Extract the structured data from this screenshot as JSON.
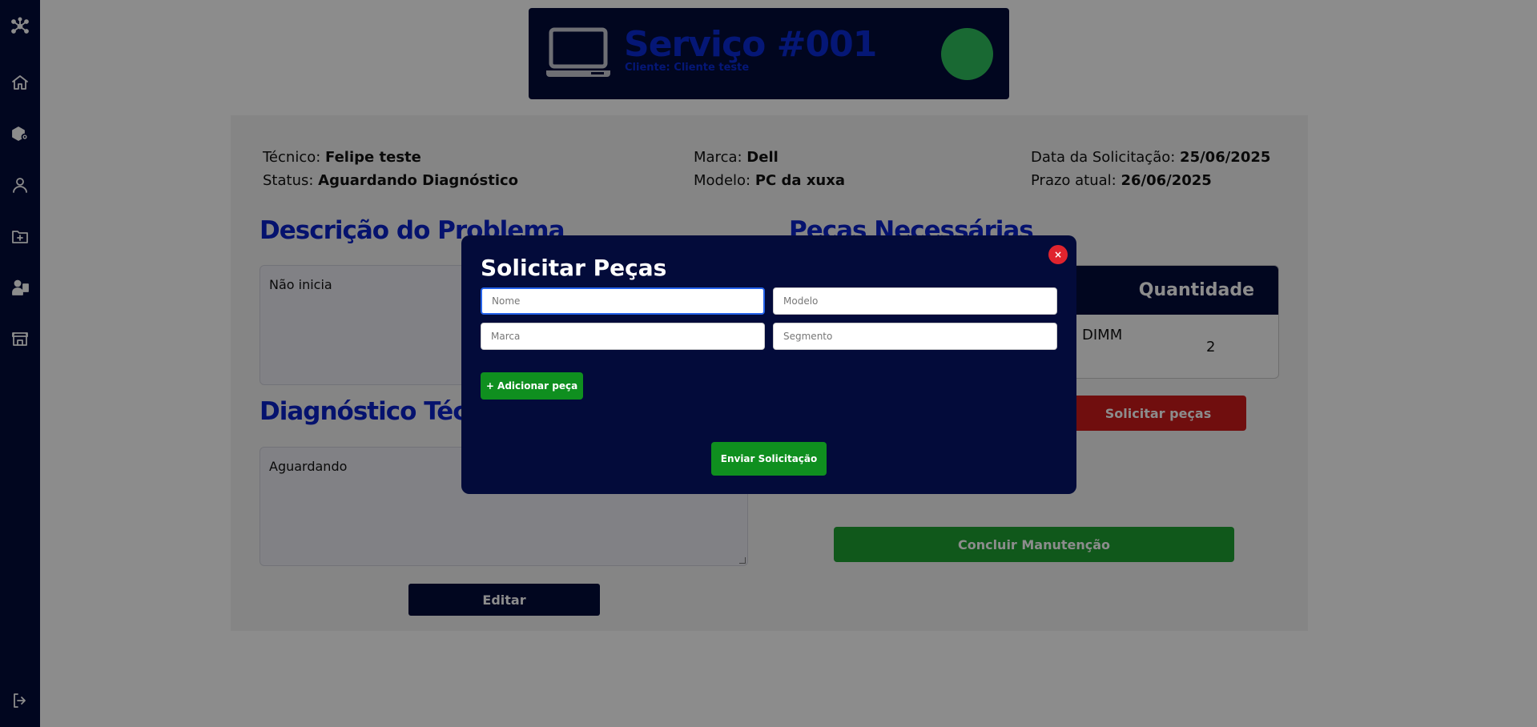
{
  "header": {
    "title": "Serviço #001",
    "subtitle": "Cliente: Cliente teste",
    "status_color": "#2fbf5d"
  },
  "sidebar": {
    "items": [
      {
        "icon": "network-icon"
      },
      {
        "icon": "home-icon"
      },
      {
        "icon": "box-gear-icon"
      },
      {
        "icon": "user-icon"
      },
      {
        "icon": "folder-add-icon"
      },
      {
        "icon": "technician-icon"
      },
      {
        "icon": "store-icon"
      },
      {
        "icon": "logout-icon"
      }
    ]
  },
  "info": {
    "tecnico_label": "Técnico:",
    "tecnico_value": "Felipe teste",
    "status_label": "Status:",
    "status_value": "Aguardando Diagnóstico",
    "marca_label": "Marca:",
    "marca_value": "Dell",
    "modelo_label": "Modelo:",
    "modelo_value": "PC da xuxa",
    "data_label": "Data da Solicitação:",
    "data_value": "25/06/2025",
    "prazo_label": "Prazo atual:",
    "prazo_value": "26/06/2025"
  },
  "problem": {
    "title": "Descrição do Problema",
    "text": "Não inicia"
  },
  "diagnostic": {
    "title": "Diagnóstico Téc",
    "text": "Aguardando",
    "edit_label": "Editar"
  },
  "parts": {
    "title": "Peças Necessárias",
    "col_quantity": "Quantidade",
    "row_name_fragment": "DIMM",
    "row_quantity": "2",
    "request_label": "Solicitar peças",
    "finish_label": "Concluir Manutenção"
  },
  "modal": {
    "title": "Solicitar Peças",
    "close_label": "×",
    "nome_placeholder": "Nome",
    "modelo_placeholder": "Modelo",
    "marca_placeholder": "Marca",
    "segmento_placeholder": "Segmento",
    "add_label": "+ Adicionar peça",
    "send_label": "Enviar Solicitação"
  },
  "colors": {
    "navy": "#030b3a",
    "title_blue": "#0a22c9",
    "green": "#0f8f1f",
    "red": "#cc1a1a",
    "close_red": "#e0242e"
  }
}
